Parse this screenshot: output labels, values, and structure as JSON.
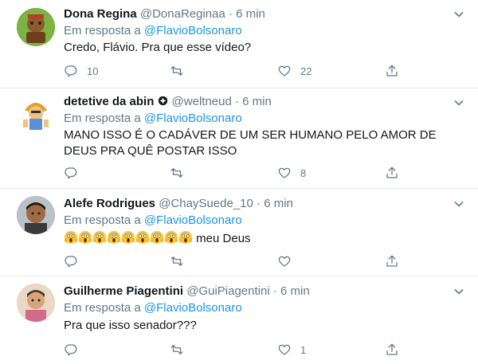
{
  "tweets": [
    {
      "name": "Dona Regina",
      "handle": "@DonaReginaa",
      "sep": "·",
      "time": "6 min",
      "reply_prefix": "Em resposta a",
      "reply_to": "@FlavioBolsonaro",
      "text": "Credo, Flávio. Pra que esse vídeo?",
      "replies": "10",
      "retweets": "",
      "likes": "22"
    },
    {
      "name": "detetive da abin",
      "handle": "@weltneud",
      "sep": "·",
      "time": "6 min",
      "reply_prefix": "Em resposta a",
      "reply_to": "@FlavioBolsonaro",
      "text": "MANO ISSO É O CADÁVER DE UM SER HUMANO PELO AMOR DE DEUS PRA QUÊ POSTAR ISSO",
      "replies": "",
      "retweets": "",
      "likes": "8"
    },
    {
      "name": "Alefe Rodrigues",
      "handle": "@ChaySuede_10",
      "sep": "·",
      "time": "6 min",
      "reply_prefix": "Em resposta a",
      "reply_to": "@FlavioBolsonaro",
      "text": "meu Deus",
      "emoji_count": "9",
      "replies": "",
      "retweets": "",
      "likes": ""
    },
    {
      "name": "Guilherme Piagentini",
      "handle": "@GuiPiagentini",
      "sep": "·",
      "time": "6 min",
      "reply_prefix": "Em resposta a",
      "reply_to": "@FlavioBolsonaro",
      "text": "Pra que isso senador???",
      "replies": "",
      "retweets": "",
      "likes": "1"
    }
  ],
  "icons": {
    "reply": "reply-icon",
    "retweet": "retweet-icon",
    "like": "heart-icon",
    "share": "share-icon",
    "caret": "chevron-down-icon",
    "emoji": "face-screaming-in-fear-emoji",
    "badge": "verified-badge-icon"
  },
  "colors": {
    "link": "#1b95e0",
    "muted": "#657786",
    "text": "#14171a",
    "separator": "#e6ecf0"
  }
}
